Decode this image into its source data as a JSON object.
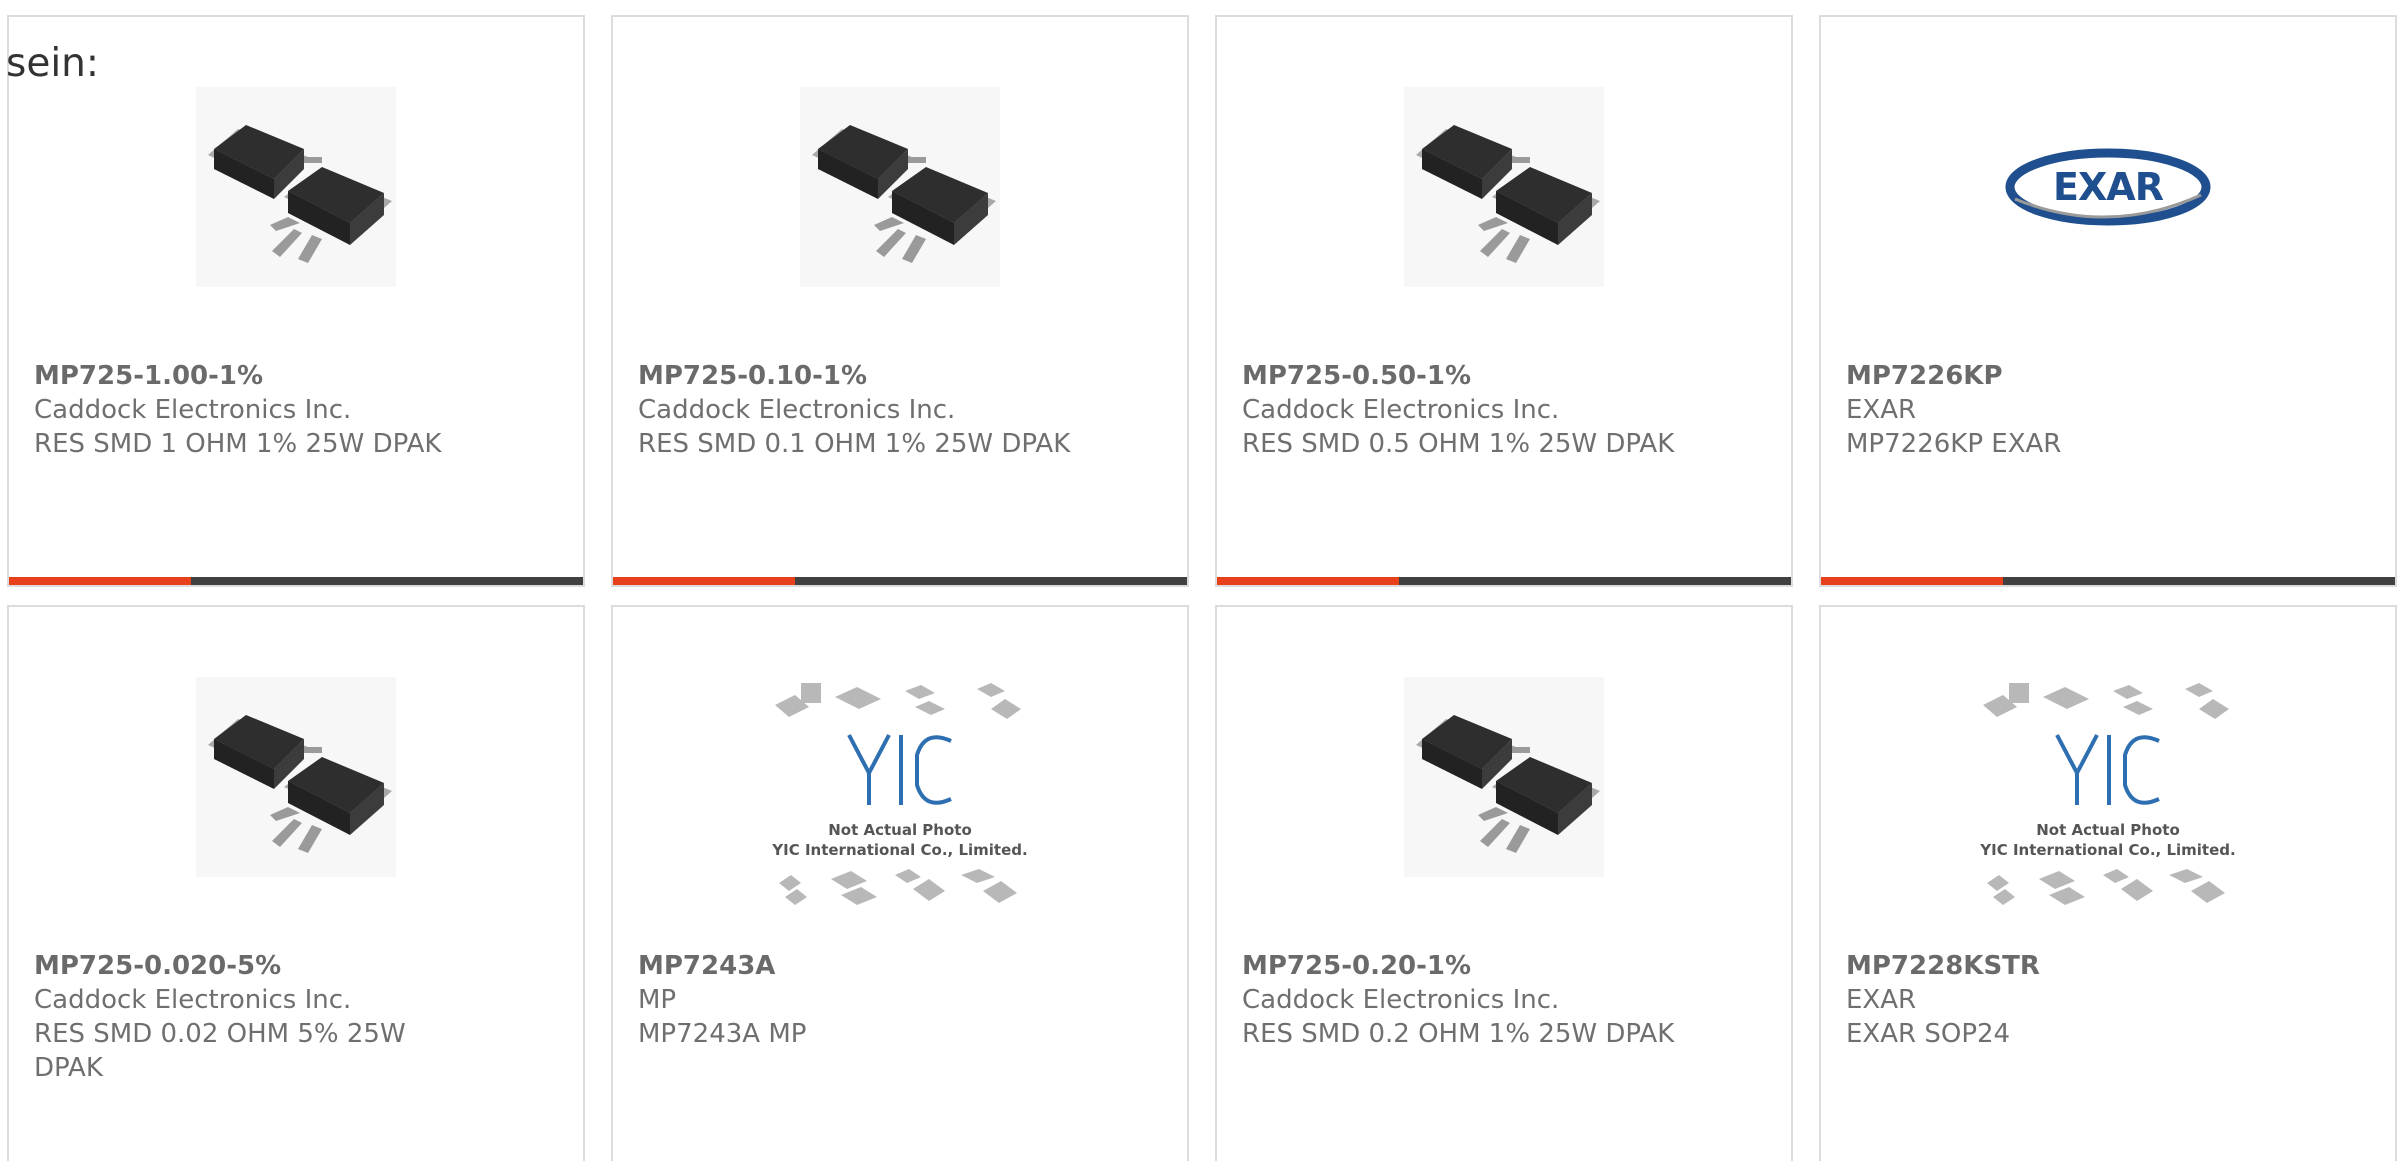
{
  "intro": {
    "text": "sein:"
  },
  "colors": {
    "accent": "#e8401c",
    "bar": "#404040",
    "text": "#6f6f6f",
    "border": "#dcdcdc"
  },
  "products": [
    {
      "part_no": "MP725-1.00-1%",
      "manufacturer": "Caddock Electronics Inc.",
      "description": "RES SMD 1 OHM 1% 25W DPAK",
      "image": "dpak-package-icon"
    },
    {
      "part_no": "MP725-0.10-1%",
      "manufacturer": "Caddock Electronics Inc.",
      "description": "RES SMD 0.1 OHM 1% 25W DPAK",
      "image": "dpak-package-icon"
    },
    {
      "part_no": "MP725-0.50-1%",
      "manufacturer": "Caddock Electronics Inc.",
      "description": "RES SMD 0.5 OHM 1% 25W DPAK",
      "image": "dpak-package-icon"
    },
    {
      "part_no": "MP7226KP",
      "manufacturer": "EXAR",
      "description": "MP7226KP EXAR",
      "image": "exar-logo",
      "logo_text": "EXAR"
    },
    {
      "part_no": "MP725-0.020-5%",
      "manufacturer": "Caddock Electronics Inc.",
      "description": "RES SMD 0.02 OHM 5% 25W DPAK",
      "image": "dpak-package-icon"
    },
    {
      "part_no": "MP7243A",
      "manufacturer": "MP",
      "description": "MP7243A MP",
      "image": "yic-placeholder",
      "placeholder_line1": "Not Actual Photo",
      "placeholder_line2": "YIC International Co., Limited."
    },
    {
      "part_no": "MP725-0.20-1%",
      "manufacturer": "Caddock Electronics Inc.",
      "description": "RES SMD 0.2 OHM 1% 25W DPAK",
      "image": "dpak-package-icon"
    },
    {
      "part_no": "MP7228KSTR",
      "manufacturer": "EXAR",
      "description": "EXAR SOP24",
      "image": "yic-placeholder",
      "placeholder_line1": "Not Actual Photo",
      "placeholder_line2": "YIC International Co., Limited."
    }
  ]
}
